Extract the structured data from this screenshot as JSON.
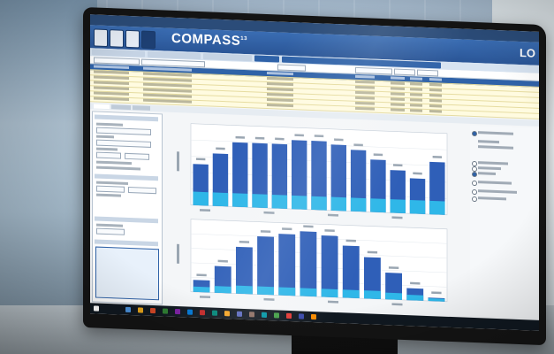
{
  "app": {
    "title": "COMPASS",
    "title_suffix": "13",
    "logo": "LO"
  },
  "colors": {
    "bar_dark": "#2f5fb8",
    "bar_light": "#2fb7e8",
    "app_bar": "#2f62a8",
    "table_bg": "#fffbe0"
  },
  "charts": {
    "top_values": [
      0.55,
      0.7,
      0.86,
      0.86,
      0.86,
      0.92,
      0.92,
      0.88,
      0.82,
      0.7,
      0.57,
      0.47,
      0.7
    ],
    "top_base": [
      0.18,
      0.18,
      0.18,
      0.18,
      0.18,
      0.18,
      0.18,
      0.18,
      0.18,
      0.18,
      0.18,
      0.18,
      0.18
    ],
    "bottom_values": [
      0.18,
      0.4,
      0.7,
      0.87,
      0.92,
      0.97,
      0.92,
      0.78,
      0.62,
      0.4,
      0.18,
      0.05
    ],
    "bottom_base": [
      0.08,
      0.1,
      0.12,
      0.12,
      0.12,
      0.12,
      0.12,
      0.12,
      0.12,
      0.1,
      0.08,
      0.04
    ]
  },
  "icons": {
    "start": "windows-start-icon",
    "search": "search-icon",
    "taskview": "task-view-icon"
  }
}
